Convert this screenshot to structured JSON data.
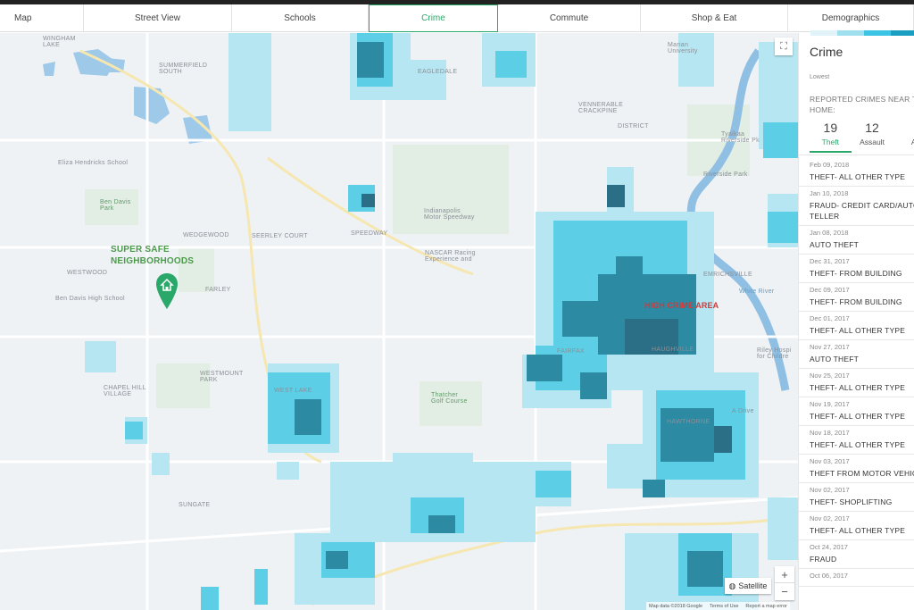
{
  "tabs": [
    {
      "label": "Map",
      "active": false
    },
    {
      "label": "Street View",
      "active": false
    },
    {
      "label": "Schools",
      "active": false
    },
    {
      "label": "Crime",
      "active": true
    },
    {
      "label": "Commute",
      "active": false
    },
    {
      "label": "Shop & Eat",
      "active": false
    },
    {
      "label": "Demographics",
      "active": false
    }
  ],
  "map": {
    "annotations": {
      "safe": "SUPER SAFE\nNEIGHBORHOODS",
      "high_crime": "HIGH CRIME AREA"
    },
    "labels": {
      "wingham_lake": "WINGHAM\nLAKE",
      "summerfield_south": "SUMMERFIELD\nSOUTH",
      "eliza_school": "Eliza Hendricks School",
      "ben_davis_park": "Ben Davis\nPark",
      "wedgewood": "WEDGEWOOD",
      "westwood": "WESTWOOD",
      "ben_davis_hs": "Ben Davis High School",
      "farley": "FARLEY",
      "seerley_court": "SEERLEY COURT",
      "indianapolis_speedway": "Indianapolis\nMotor Speedway",
      "nascar": "NASCAR Racing\nExperience and",
      "speedway": "SPEEDWAY",
      "westmount_park": "WESTMOUNT\nPARK",
      "chapel_hill": "CHAPEL HILL\nVILLAGE",
      "westlake": "WEST LAKE",
      "thatcher": "Thatcher\nGolf Course",
      "sungate": "SUNGATE",
      "eagledale": "EAGLEDALE",
      "vennerable": "VENNERABLE\nCRACKPINE",
      "haughville": "HAUGHVILLE",
      "fairfax": "FAIRFAX",
      "emrichsville": "EMRICHSVILLE",
      "hawthorne": "HAWTHORNE",
      "riverside": "Riverside Park",
      "riley": "Riley Hospi\nfor Childre",
      "marian": "Marian\nUniversity",
      "tyalkaaa": "Tyalkaa\nRiverside Pk",
      "white_river": "White River",
      "a_drive": "A Drive",
      "district": "DISTRICT"
    },
    "controls": {
      "satellite": "Satellite",
      "zoom_in": "+",
      "zoom_out": "−",
      "fullscreen": "⛶"
    },
    "attribution": [
      "Map data ©2018 Google",
      "Terms of Use",
      "Report a map error"
    ],
    "colors": {
      "crime_light": "#b6e6f2",
      "crime_mid": "#5ccfe6",
      "crime_strong": "#1fb6d6",
      "crime_dark": "#2d8aa3",
      "crime_darkest": "#2a6f86",
      "safe_pin": "#2aa86a",
      "annotation_green": "#4a9a4a",
      "annotation_red": "#d23a3a"
    }
  },
  "panel": {
    "title": "Crime",
    "legend_low": "Lowest",
    "legend_colors": [
      "#dff3f9",
      "#9fdfee",
      "#3cc4e4",
      "#1a9fc3",
      "#127a96"
    ],
    "reported": "REPORTED CRIMES NEAR THIS\nHOME:",
    "counts": [
      {
        "num": "19",
        "label": "Theft",
        "active": true
      },
      {
        "num": "12",
        "label": "Assault",
        "active": false
      },
      {
        "num": "",
        "label": "A",
        "active": false
      }
    ],
    "crimes": [
      {
        "date": "Feb 09, 2018",
        "type": "THEFT- ALL OTHER TYPE"
      },
      {
        "date": "Jan 10, 2018",
        "type": "FRAUD- CREDIT CARD/AUTO\nTELLER"
      },
      {
        "date": "Jan 08, 2018",
        "type": "AUTO THEFT"
      },
      {
        "date": "Dec 31, 2017",
        "type": "THEFT- FROM BUILDING"
      },
      {
        "date": "Dec 09, 2017",
        "type": "THEFT- FROM BUILDING"
      },
      {
        "date": "Dec 01, 2017",
        "type": "THEFT- ALL OTHER TYPE"
      },
      {
        "date": "Nov 27, 2017",
        "type": "AUTO THEFT"
      },
      {
        "date": "Nov 25, 2017",
        "type": "THEFT- ALL OTHER TYPE"
      },
      {
        "date": "Nov 19, 2017",
        "type": "THEFT- ALL OTHER TYPE"
      },
      {
        "date": "Nov 18, 2017",
        "type": "THEFT- ALL OTHER TYPE"
      },
      {
        "date": "Nov 03, 2017",
        "type": "THEFT FROM MOTOR VEHICLE"
      },
      {
        "date": "Nov 02, 2017",
        "type": "THEFT- SHOPLIFTING"
      },
      {
        "date": "Nov 02, 2017",
        "type": "THEFT- ALL OTHER TYPE"
      },
      {
        "date": "Oct 24, 2017",
        "type": "FRAUD"
      },
      {
        "date": "Oct 06, 2017",
        "type": ""
      }
    ]
  }
}
